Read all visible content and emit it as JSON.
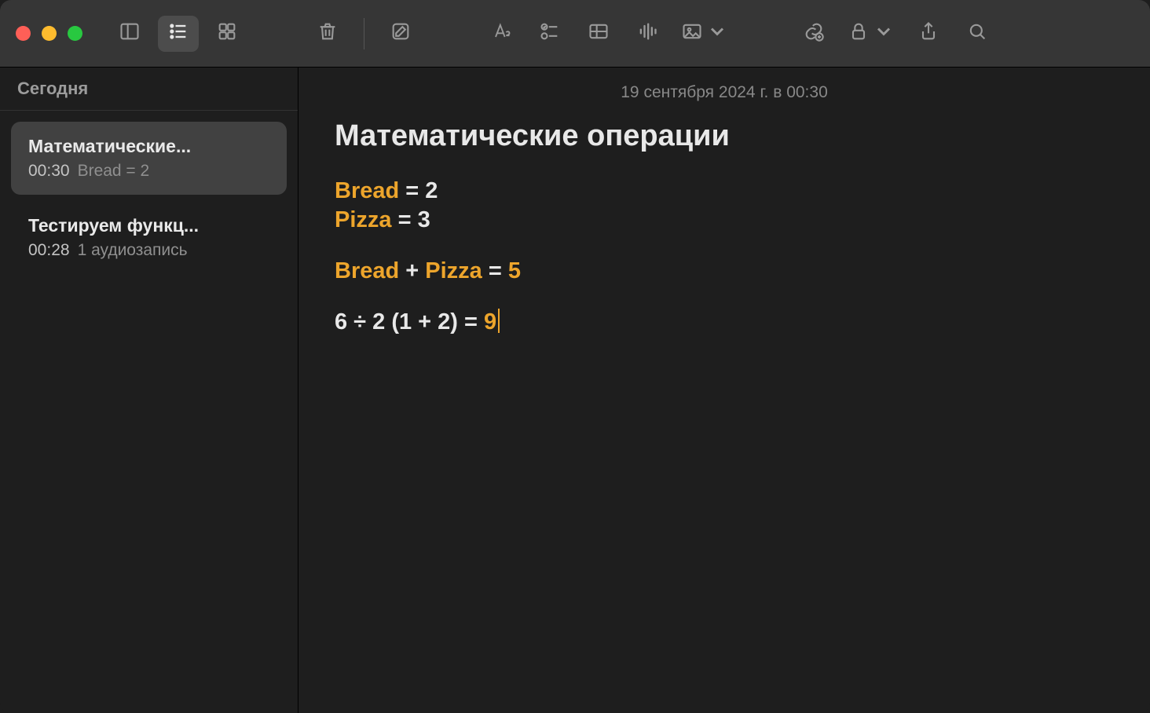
{
  "toolbar": {
    "icons": {
      "sidebar": "sidebar-toggle-icon",
      "list": "list-view-icon",
      "grid": "grid-view-icon",
      "trash": "trash-icon",
      "compose": "compose-icon",
      "format": "format-text-icon",
      "checklist": "checklist-icon",
      "table": "table-icon",
      "audio": "audio-waveform-icon",
      "media": "photo-icon",
      "link": "link-add-icon",
      "lock": "lock-icon",
      "share": "share-icon",
      "search": "search-icon"
    }
  },
  "sidebar": {
    "section_label": "Сегодня",
    "items": [
      {
        "title": "Математические...",
        "time": "00:30",
        "preview": "Bread = 2",
        "selected": true
      },
      {
        "title": "Тестируем функц...",
        "time": "00:28",
        "preview": "1 аудиозапись",
        "selected": false
      }
    ]
  },
  "note": {
    "date": "19 сентября 2024 г. в 00:30",
    "title": "Математические операции",
    "lines": {
      "l1_var": "Bread",
      "l1_rest": " = 2",
      "l2_var": "Pizza",
      "l2_rest": " = 3",
      "l3_var1": "Bread",
      "l3_mid": " + ",
      "l3_var2": "Pizza",
      "l3_eq": "  = ",
      "l3_ans": "5",
      "l4_expr": "6 ÷ 2 (1 + 2)  = ",
      "l4_ans": "9"
    }
  },
  "colors": {
    "accent": "#eda52c",
    "bg": "#1e1e1e",
    "toolbar": "#363636"
  }
}
